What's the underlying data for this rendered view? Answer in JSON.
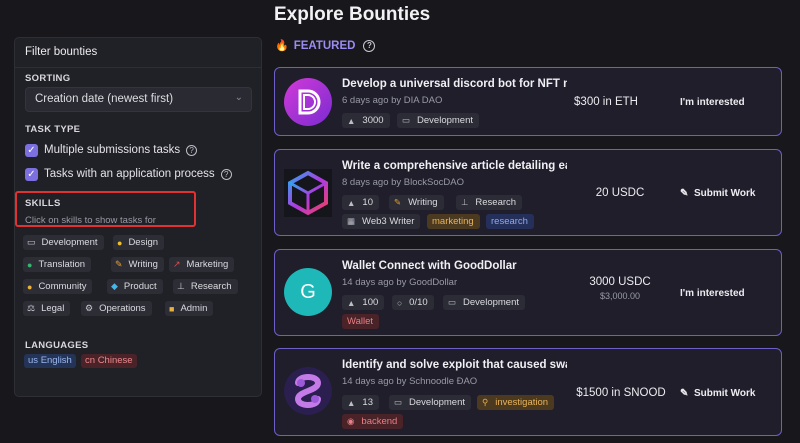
{
  "page": {
    "title": "Explore Bounties"
  },
  "sidebar": {
    "header": "Filter bounties",
    "sorting": {
      "label": "SORTING",
      "selected": "Creation date (newest first)"
    },
    "task_type": {
      "label": "TASK TYPE",
      "options": [
        {
          "label": "Multiple submissions tasks",
          "checked": true
        },
        {
          "label": "Tasks with an application process",
          "checked": true
        }
      ]
    },
    "skills": {
      "label": "SKILLS",
      "hint": "Click on skills to show tasks for",
      "items": [
        {
          "label": "Development",
          "icon": "laptop-icon"
        },
        {
          "label": "Design",
          "icon": "palette-icon"
        },
        {
          "label": "Translation",
          "icon": "globe-icon"
        },
        {
          "label": "Writing",
          "icon": "pen-icon"
        },
        {
          "label": "Marketing",
          "icon": "chart-icon"
        },
        {
          "label": "Community",
          "icon": "people-icon"
        },
        {
          "label": "Product",
          "icon": "diamond-icon"
        },
        {
          "label": "Research",
          "icon": "flask-icon"
        },
        {
          "label": "Legal",
          "icon": "scales-icon"
        },
        {
          "label": "Operations",
          "icon": "gear-icon"
        },
        {
          "label": "Admin",
          "icon": "folder-icon"
        }
      ]
    },
    "languages": {
      "label": "LANGUAGES",
      "items": [
        {
          "flag": "us",
          "label": "English"
        },
        {
          "flag": "cn",
          "label": "Chinese"
        }
      ]
    }
  },
  "featured": {
    "label": "FEATURED",
    "icon": "fire-icon"
  },
  "bounties": [
    {
      "title": "Develop a universal discord bot for NFT mi...",
      "meta": "6 days ago by DIA DAO",
      "points": "3000",
      "skill": "Development",
      "reward": "$300 in ETH",
      "action": "I'm interested",
      "logo_color": "#b02fd0"
    },
    {
      "title": "Write a comprehensive article detailing eac...",
      "meta": "8 days ago by BlockSocDAO",
      "points": "10",
      "skill": "Writing",
      "skill2": "Research",
      "skill3": "Web3 Writer",
      "tags": [
        "marketing",
        "research"
      ],
      "reward": "20 USDC",
      "action": "Submit Work"
    },
    {
      "title": "Wallet Connect with GoodDollar",
      "meta": "14 days ago by GoodDollar",
      "points": "100",
      "progress": "0/10",
      "skill": "Development",
      "tags": [
        "Wallet"
      ],
      "reward": "3000 USDC",
      "reward_sub": "$3,000.00",
      "logo_letter": "G",
      "action": "I'm interested"
    },
    {
      "title": "Identify and solve exploit that caused swap ...",
      "meta": "14 days ago by Schnoodle ÐAO",
      "points": "13",
      "skill": "Development",
      "tags": [
        "investigation",
        "backend"
      ],
      "reward": "$1500 in SNOOD",
      "action": "Submit Work"
    }
  ]
}
